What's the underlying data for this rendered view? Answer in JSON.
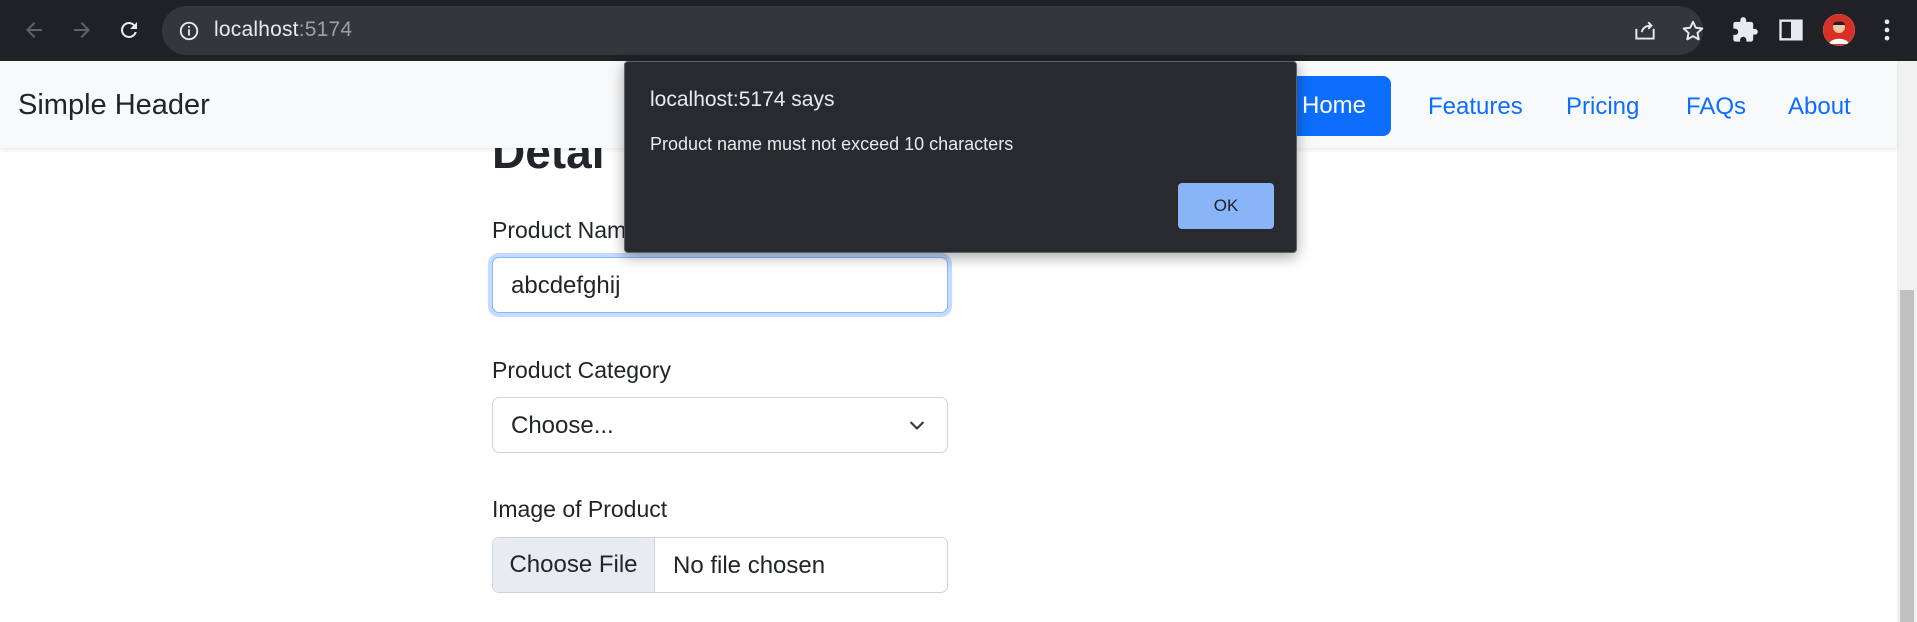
{
  "browser": {
    "url_host": "localhost",
    "url_port": ":5174",
    "icons": [
      "back-icon",
      "forward-icon",
      "reload-icon",
      "info-icon",
      "share-icon",
      "star-icon",
      "extensions-icon",
      "side-panel-icon",
      "menu-icon"
    ]
  },
  "header": {
    "brand": "Simple Header",
    "nav": [
      {
        "label": "Home",
        "active": true
      },
      {
        "label": "Features"
      },
      {
        "label": "Pricing"
      },
      {
        "label": "FAQs"
      },
      {
        "label": "About"
      }
    ]
  },
  "form": {
    "heading": "Detai",
    "product_name_label": "Product Nam",
    "product_name_value": "abcdefghij",
    "category_label": "Product Category",
    "category_value": "Choose...",
    "image_label": "Image of Product",
    "file_button": "Choose File",
    "file_status": "No file chosen"
  },
  "dialog": {
    "title": "localhost:5174 says",
    "message": "Product name must not exceed 10 characters",
    "ok_label": "OK"
  },
  "colors": {
    "primary": "#0d6efd",
    "dialog_bg": "#292a2d",
    "dialog_button": "#8ab4f8"
  }
}
